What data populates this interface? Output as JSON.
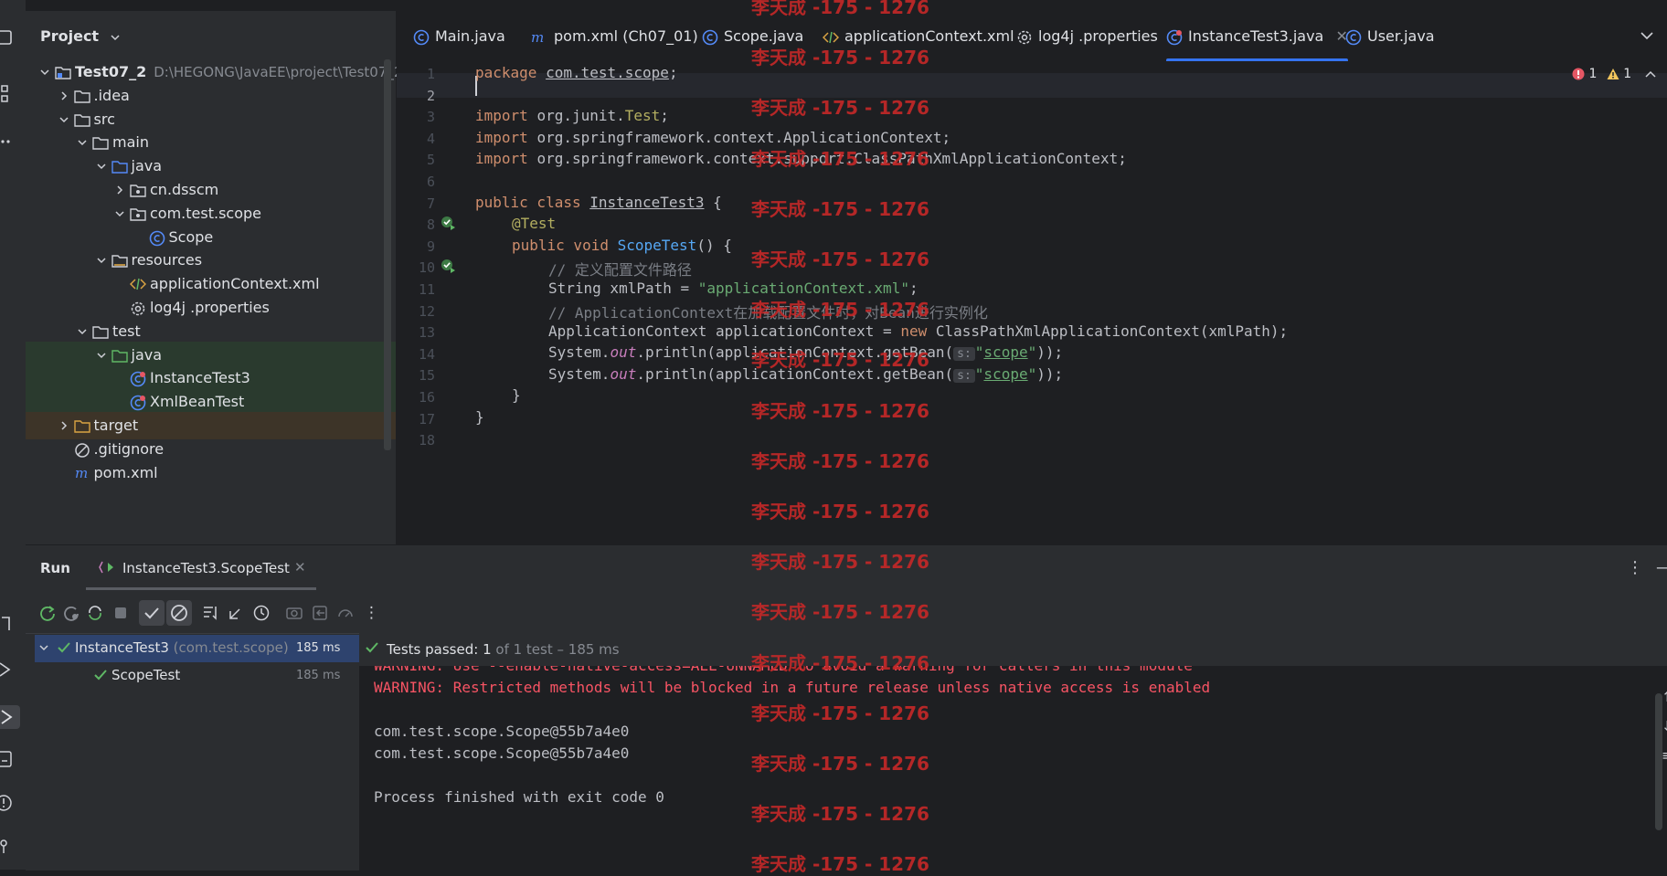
{
  "project": {
    "title": "Project",
    "tree": [
      {
        "label": "Test07_2",
        "hint": "D:\\HEGONG\\JavaEE\\project\\Test07_2",
        "icon": "module-folder-icon",
        "indent": 0,
        "chev": "down"
      },
      {
        "label": ".idea",
        "icon": "folder-icon",
        "indent": 1,
        "chev": "right"
      },
      {
        "label": "src",
        "icon": "folder-icon",
        "indent": 1,
        "chev": "down"
      },
      {
        "label": "main",
        "icon": "folder-icon",
        "indent": 2,
        "chev": "down"
      },
      {
        "label": "java",
        "icon": "source-folder-icon",
        "indent": 3,
        "chev": "down"
      },
      {
        "label": "cn.dsscm",
        "icon": "package-icon",
        "indent": 4,
        "chev": "right"
      },
      {
        "label": "com.test.scope",
        "icon": "package-icon",
        "indent": 4,
        "chev": "down"
      },
      {
        "label": "Scope",
        "icon": "class-icon",
        "indent": 5,
        "chev": ""
      },
      {
        "label": "resources",
        "icon": "resources-folder-icon",
        "indent": 3,
        "chev": "down"
      },
      {
        "label": "applicationContext.xml",
        "icon": "xml-file-icon",
        "indent": 4,
        "chev": ""
      },
      {
        "label": "log4j .properties",
        "icon": "properties-file-icon",
        "indent": 4,
        "chev": ""
      },
      {
        "label": "test",
        "icon": "folder-icon",
        "indent": 2,
        "chev": "down"
      },
      {
        "label": "java",
        "icon": "test-folder-icon",
        "indent": 3,
        "chev": "down"
      },
      {
        "label": "InstanceTest3",
        "icon": "test-class-icon",
        "indent": 4,
        "chev": ""
      },
      {
        "label": "XmlBeanTest",
        "icon": "test-class-icon",
        "indent": 4,
        "chev": ""
      },
      {
        "label": "target",
        "icon": "folder-orange-icon",
        "indent": 1,
        "chev": "right"
      },
      {
        "label": ".gitignore",
        "icon": "ignore-file-icon",
        "indent": 1,
        "chev": ""
      },
      {
        "label": "pom.xml",
        "icon": "maven-icon",
        "indent": 1,
        "chev": ""
      }
    ]
  },
  "tabs": [
    {
      "label": "Main.java",
      "icon": "class-icon"
    },
    {
      "label": "pom.xml (Ch07_01)",
      "icon": "maven-icon"
    },
    {
      "label": "Scope.java",
      "icon": "class-icon"
    },
    {
      "label": "applicationContext.xml",
      "icon": "xml-file-icon"
    },
    {
      "label": "log4j .properties",
      "icon": "properties-file-icon"
    },
    {
      "label": "InstanceTest3.java",
      "icon": "test-class-icon",
      "active": true
    },
    {
      "label": "User.java",
      "icon": "class-icon"
    }
  ],
  "editor": {
    "line_numbers": [
      "1",
      "2",
      "3",
      "4",
      "5",
      "6",
      "7",
      "8",
      "9",
      "10",
      "11",
      "12",
      "13",
      "14",
      "15",
      "16",
      "17",
      "18"
    ],
    "inspections": {
      "errors": "1",
      "warnings": "1"
    },
    "code": {
      "l1_kw": "package",
      "l1_pkg": "com.test.scope",
      "l1_end": ";",
      "l3_kw": "import",
      "l3_a": "org.junit.",
      "l3_b": "Test",
      "l3_end": ";",
      "l4_kw": "import",
      "l4_rest": "org.springframework.context.ApplicationContext;",
      "l5_kw": "import",
      "l5_rest": "org.springframework.context.support.ClassPathXmlApplicationContext;",
      "l7_kw": "public class",
      "l7_name": "InstanceTest3",
      "l7_end": " {",
      "l8_ann": "@Test",
      "l9_kw": "public void",
      "l9_fn": "ScopeTest",
      "l9_end": "() {",
      "l10": "// 定义配置文件路径",
      "l11_a": "String xmlPath = ",
      "l11_str": "\"applicationContext.xml\"",
      "l11_end": ";",
      "l12": "// ApplicationContext在加载配置文件时，对Bean进行实例化",
      "l13_a": "ApplicationContext applicationContext = ",
      "l13_kw": "new",
      "l13_b": " ClassPathXmlApplicationContext(xmlPath);",
      "l14_a": "System.",
      "l14_out": "out",
      "l14_b": ".println(applicationContext.getBean(",
      "l14_hint": "s:",
      "l14_q1": "\"",
      "l14_str": "scope",
      "l14_q2": "\"",
      "l14_end": "));",
      "l15_a": "System.",
      "l15_out": "out",
      "l15_b": ".println(applicationContext.getBean(",
      "l15_hint": "s:",
      "l15_q1": "\"",
      "l15_str": "scope",
      "l15_q2": "\"",
      "l15_end": "));",
      "l16": "}",
      "l17": "}"
    }
  },
  "run": {
    "title": "Run",
    "config_tab": "InstanceTest3.ScopeTest",
    "tests": [
      {
        "label": "InstanceTest3",
        "hint": "(com.test.scope)",
        "time": "185 ms"
      },
      {
        "label": "ScopeTest",
        "time": "185 ms"
      }
    ],
    "status_prefix": "Tests passed:",
    "status_count": "1",
    "status_suffix": "of 1 test – 185 ms",
    "console": [
      "WARNING: Use --enable-native-access=ALL-UNNAMED to avoid a warning for callers in this module",
      "WARNING: Restricted methods will be blocked in a future release unless native access is enabled",
      "",
      "com.test.scope.Scope@55b7a4e0",
      "com.test.scope.Scope@55b7a4e0",
      "",
      "Process finished with exit code 0"
    ]
  },
  "watermark": "李天成 -175 - 1276",
  "colors": {
    "accent": "#3574f0",
    "pass": "#5fb865",
    "warning_text": "#f75464",
    "watermark": "#c62828"
  }
}
